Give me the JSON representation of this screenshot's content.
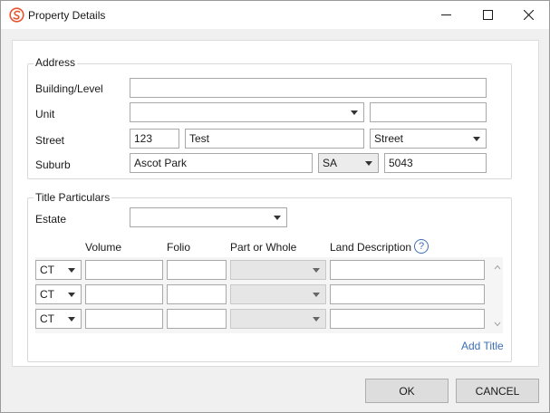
{
  "window": {
    "title": "Property Details",
    "accent": "#e8542f"
  },
  "address": {
    "group_label": "Address",
    "building_label": "Building/Level",
    "building_value": "",
    "unit_label": "Unit",
    "unit_value": "",
    "unit_number": "",
    "street_label": "Street",
    "street_number": "123",
    "street_name": "Test",
    "street_type": "Street",
    "suburb_label": "Suburb",
    "suburb": "Ascot Park",
    "state": "SA",
    "postcode": "5043"
  },
  "title_particulars": {
    "group_label": "Title Particulars",
    "estate_label": "Estate",
    "estate_value": "",
    "columns": [
      "Volume",
      "Folio",
      "Part or Whole",
      "Land Description"
    ],
    "rows": [
      {
        "type": "CT",
        "volume": "",
        "folio": "",
        "part": "",
        "description": ""
      },
      {
        "type": "CT",
        "volume": "",
        "folio": "",
        "part": "",
        "description": ""
      },
      {
        "type": "CT",
        "volume": "",
        "folio": "",
        "part": "",
        "description": ""
      }
    ],
    "add_title": "Add Title",
    "help_glyph": "?"
  },
  "buttons": {
    "ok": "OK",
    "cancel": "CANCEL"
  }
}
